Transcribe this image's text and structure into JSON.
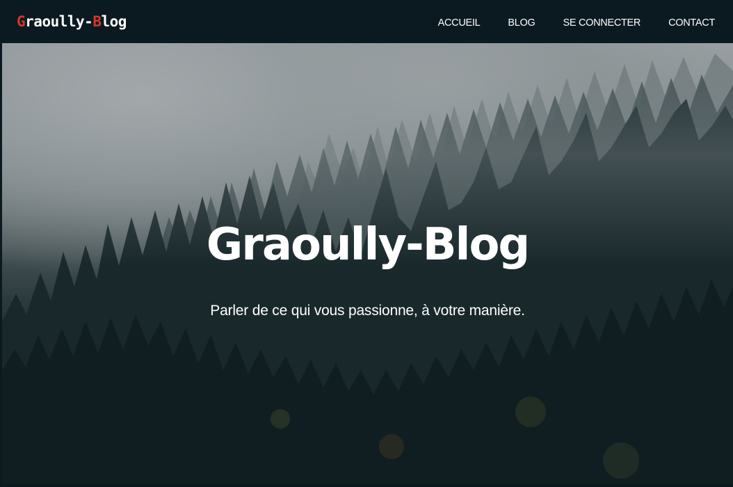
{
  "brand": {
    "first_letter": "G",
    "middle": "raoully-",
    "accent_letter": "B",
    "end": "log"
  },
  "nav": {
    "items": [
      {
        "label": "ACCUEIL"
      },
      {
        "label": "BLOG"
      },
      {
        "label": "SE CONNECTER"
      },
      {
        "label": "CONTACT"
      }
    ]
  },
  "hero": {
    "title": "Graoully-Blog",
    "subtitle": "Parler de ce qui vous passionne, à votre manière."
  },
  "colors": {
    "navbar_bg": "#0b1a20",
    "brand_accent": "#d9342b",
    "text": "#ffffff"
  }
}
